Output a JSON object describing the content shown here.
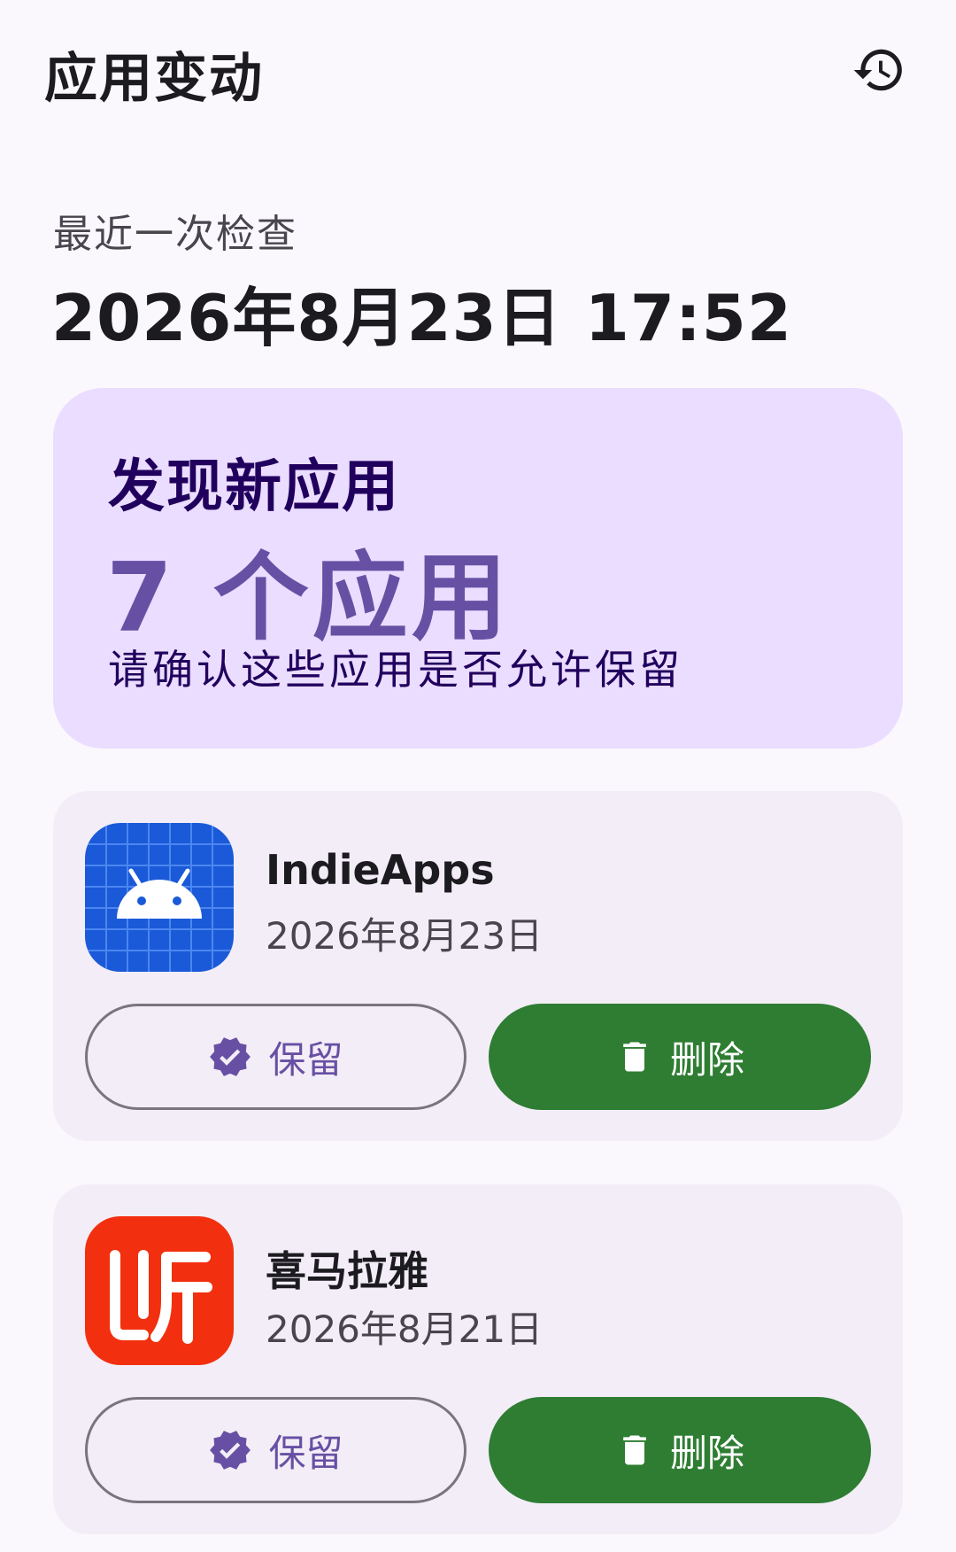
{
  "appbar": {
    "title": "应用变动",
    "history_icon": "history-icon"
  },
  "last_check": {
    "label": "最近一次检查",
    "time": "2026年8月23日 17:52"
  },
  "summary": {
    "heading": "发现新应用",
    "count": "7 个应用",
    "note": "请确认这些应用是否允许保留",
    "background": "#EADDFF",
    "accent": "#6750A4"
  },
  "apps": [
    {
      "name": "IndieApps",
      "date": "2026年8月23日",
      "icon": "android-icon",
      "keep_label": "保留",
      "delete_label": "删除"
    },
    {
      "name": "喜马拉雅",
      "date": "2026年8月21日",
      "icon": "ximalaya-icon",
      "keep_label": "保留",
      "delete_label": "删除"
    }
  ],
  "colors": {
    "delete_button": "#2E7D32",
    "keep_text": "#6750A4",
    "card_background": "#F3EDF7"
  }
}
